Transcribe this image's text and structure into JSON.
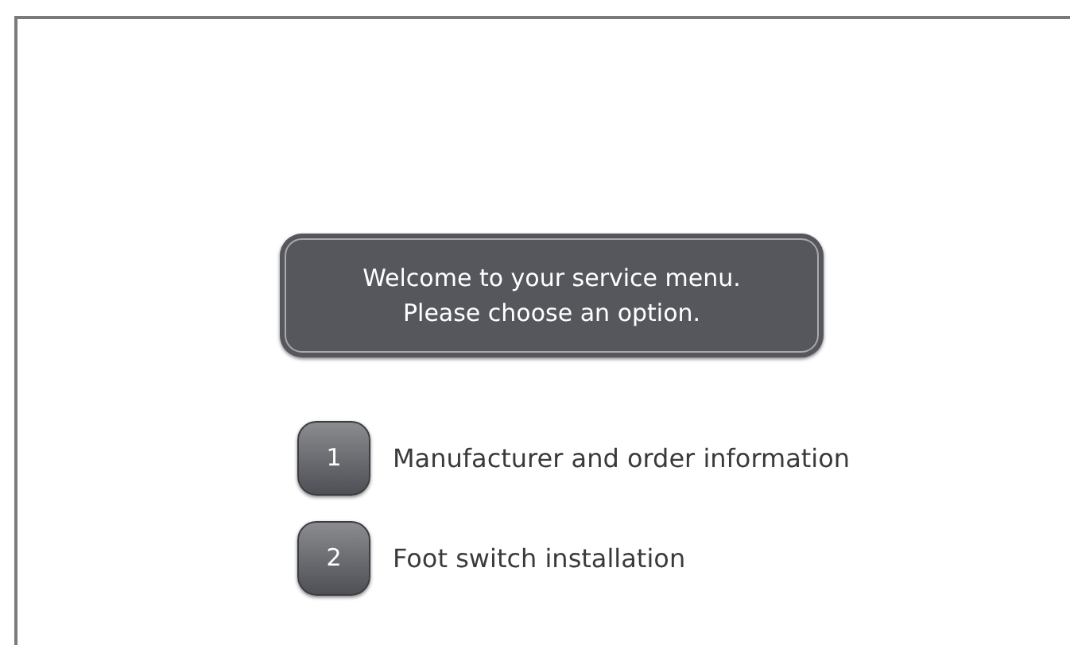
{
  "message": [
    "Welcome to your service menu.",
    "Please choose an option."
  ],
  "options": [
    {
      "key": "1",
      "label": "Manufacturer and order information"
    },
    {
      "key": "2",
      "label": "Foot switch installation"
    }
  ]
}
